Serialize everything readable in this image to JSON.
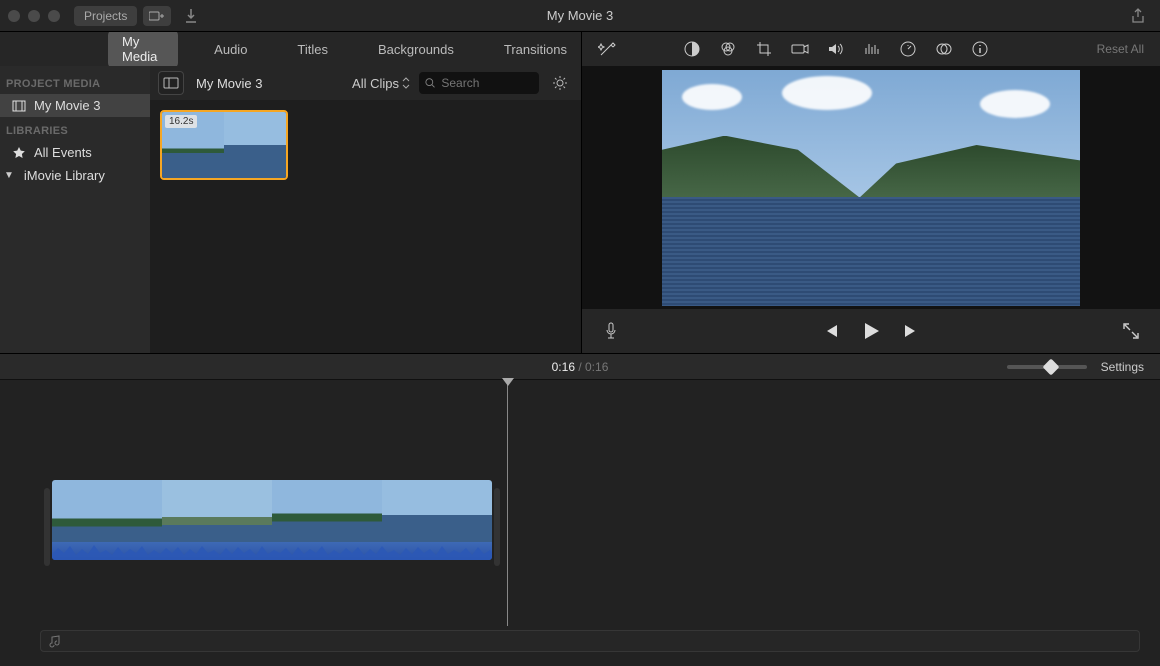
{
  "titlebar": {
    "projects_btn": "Projects",
    "title": "My Movie 3"
  },
  "browser": {
    "tabs": {
      "my_media": "My Media",
      "audio": "Audio",
      "titles": "Titles",
      "backgrounds": "Backgrounds",
      "transitions": "Transitions"
    },
    "sidebar": {
      "project_media_label": "PROJECT MEDIA",
      "project_item": "My Movie 3",
      "libraries_label": "LIBRARIES",
      "all_events": "All Events",
      "imovie_library": "iMovie Library"
    },
    "content": {
      "title": "My Movie 3",
      "filter": "All Clips",
      "search_placeholder": "Search",
      "clip_duration": "16.2s"
    }
  },
  "viewer": {
    "reset": "Reset All"
  },
  "timebar": {
    "current": "0:16",
    "sep": " / ",
    "total": "0:16",
    "settings": "Settings"
  }
}
